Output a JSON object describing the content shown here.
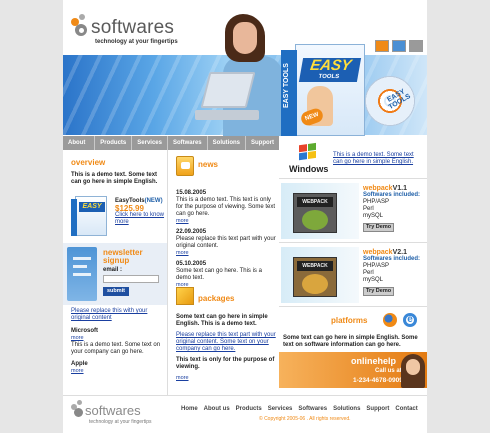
{
  "brand": {
    "name": "softwares",
    "tagline": "technology at your fingertips",
    "accent": "#f08a16",
    "link": "#1a3fa0"
  },
  "header": {
    "buttons": [
      "home-icon",
      "mail-icon",
      "sitemap-icon"
    ],
    "box": {
      "brand_top": "EASY",
      "brand_bottom": "TOOLS",
      "side": "EASY TOOLS",
      "badge": "NEW",
      "cd": "EASY TOOLS"
    }
  },
  "nav": [
    "About us",
    "Products",
    "Services",
    "Softwares",
    "Solutions",
    "Support"
  ],
  "overview": {
    "title": "overview",
    "text": "This is a demo text. Some text can go here in simple English.",
    "product": {
      "box_label": "EASY",
      "name": "EasyTools",
      "badge": "(NEW)",
      "price": "$125.99",
      "link": "Click here to know more"
    }
  },
  "newsletter": {
    "title1": "newsletter",
    "title2": "signup",
    "email_label": "email :",
    "email_value": "",
    "submit": "submit"
  },
  "left_bottom": {
    "link": "Please replace this with your original content",
    "items": [
      {
        "title": "Microsoft",
        "more": "more",
        "text": "This is a demo text. Some text on your company can go here."
      },
      {
        "title": "Apple",
        "more": "more"
      }
    ]
  },
  "news": {
    "title": "news",
    "items": [
      {
        "date": "15.08.2005",
        "text": "This is a demo text. This text is only for the purpose of viewing. Some text can go here.",
        "more": "more"
      },
      {
        "date": "22.09.2005",
        "text": "Please replace this text part with your original content.",
        "more": "more"
      },
      {
        "date": "05.10.2005",
        "text": "Some text can go here. This is a demo text.",
        "more": "more"
      }
    ]
  },
  "packages": {
    "title": "packages",
    "text1": "Some text can go here in simple English. This is a demo text.",
    "link": "Please replace this text part with your original content. Some text on your company can go here.",
    "text2": "This text is only for the purpose of viewing.",
    "more": "more"
  },
  "windows": {
    "label": "Windows",
    "text": "This is a demo text. Some text can go here in simple English."
  },
  "webpacks": [
    {
      "name": "webpack",
      "version": "V1.1",
      "box": "WEBPACK",
      "heading": "Softwares included:",
      "items": [
        "PHP/ASP",
        "Perl",
        "mySQL"
      ],
      "button": "Try Demo"
    },
    {
      "name": "webpack",
      "version": "V2.1",
      "box": "WEBPACK",
      "heading": "Softwares included:",
      "items": [
        "PHP/ASP",
        "Perl",
        "mySQL"
      ],
      "button": "Try Demo"
    }
  ],
  "platforms": {
    "title": "platforms",
    "text": "Some text can go here in simple English. Some text on software information can go here."
  },
  "onlinehelp": {
    "title": "onlinehelp",
    "call": "Call us at :",
    "phone": "1-234-4678-0909"
  },
  "footer": {
    "links": [
      "Home",
      "About us",
      "Products",
      "Services",
      "Softwares",
      "Solutions",
      "Support",
      "Contact"
    ],
    "copyright": "© Copyright 2005-06 . All rights reserved."
  }
}
